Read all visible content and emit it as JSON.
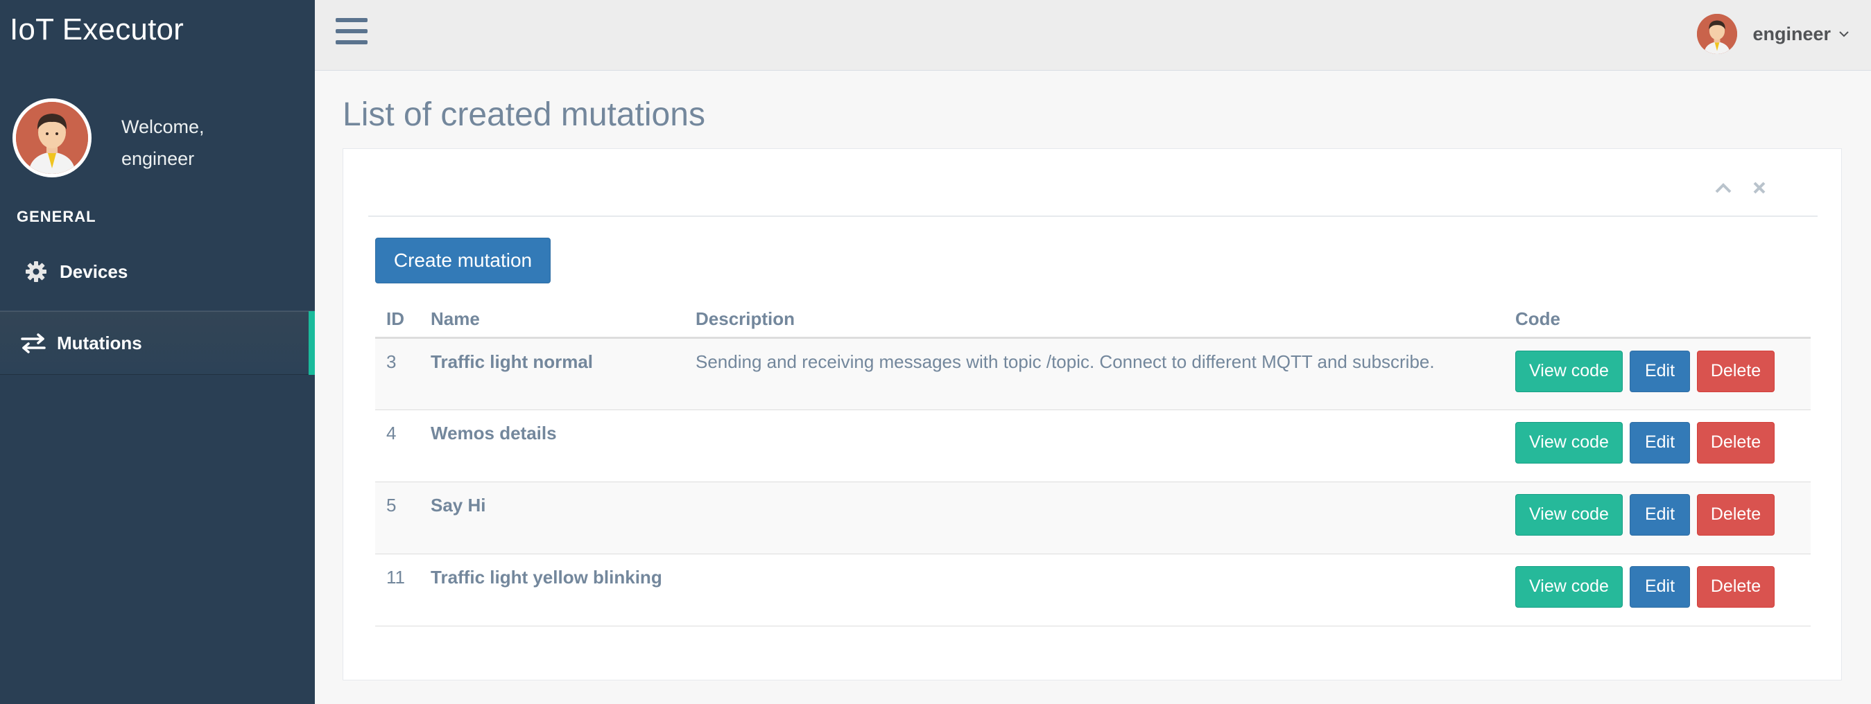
{
  "sidebar": {
    "app_title": "IoT Executor",
    "welcome": "Welcome,",
    "username": "engineer",
    "section_title": "GENERAL",
    "items": [
      {
        "label": "Devices",
        "icon": "gear-icon"
      },
      {
        "label": "Mutations",
        "icon": "exchange-icon",
        "active": true
      }
    ]
  },
  "topnav": {
    "username": "engineer"
  },
  "main": {
    "page_title": "List of created mutations",
    "create_button": "Create mutation",
    "table": {
      "headers": [
        "ID",
        "Name",
        "Description",
        "Code"
      ],
      "rows": [
        {
          "id": "3",
          "name": "Traffic light normal",
          "description": "Sending and receiving messages with topic /topic. Connect to different MQTT and subscribe."
        },
        {
          "id": "4",
          "name": "Wemos details",
          "description": ""
        },
        {
          "id": "5",
          "name": "Say Hi",
          "description": ""
        },
        {
          "id": "11",
          "name": "Traffic light yellow blinking",
          "description": ""
        }
      ],
      "actions": {
        "view": "View code",
        "edit": "Edit",
        "delete": "Delete"
      }
    }
  },
  "colors": {
    "sidebar_bg": "#2a3f54",
    "active_accent": "#1abb9c",
    "btn_primary": "#337ab7",
    "btn_success": "#26b99a",
    "btn_danger": "#d9534f"
  }
}
